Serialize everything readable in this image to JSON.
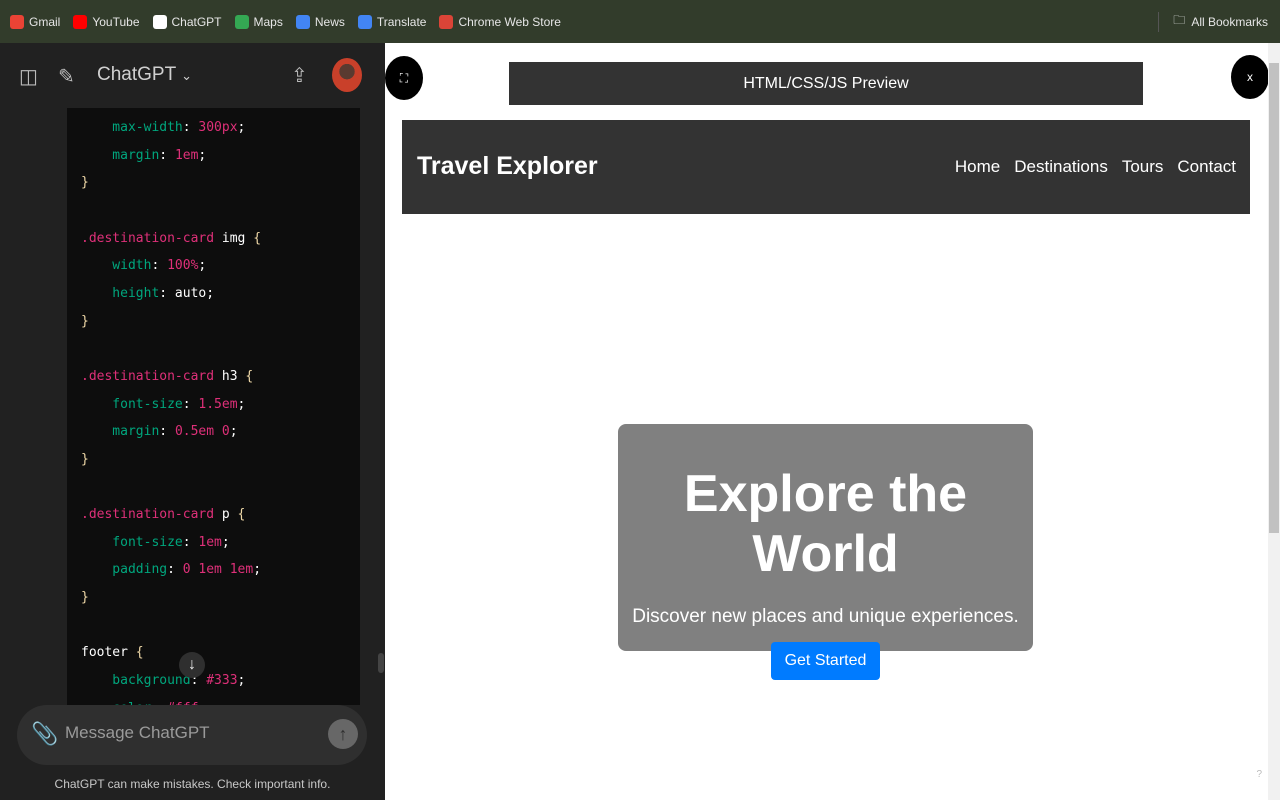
{
  "bookmarks": [
    {
      "label": "Gmail",
      "color": "#ea4335"
    },
    {
      "label": "YouTube",
      "color": "#ff0000"
    },
    {
      "label": "ChatGPT",
      "color": "#ffffff"
    },
    {
      "label": "Maps",
      "color": "#34a853"
    },
    {
      "label": "News",
      "color": "#4285f4"
    },
    {
      "label": "Translate",
      "color": "#4285f4"
    },
    {
      "label": "Chrome Web Store",
      "color": "#db4437"
    }
  ],
  "all_bookmarks": "All Bookmarks",
  "chat": {
    "title": "ChatGPT",
    "placeholder": "Message ChatGPT",
    "disclaimer": "ChatGPT can make mistakes. Check important info."
  },
  "code_lines": [
    [
      [
        "prop",
        "    max-width"
      ],
      [
        "p",
        ": "
      ],
      [
        "val",
        "300px"
      ],
      [
        "p",
        ";"
      ]
    ],
    [
      [
        "prop",
        "    margin"
      ],
      [
        "p",
        ": "
      ],
      [
        "val",
        "1em"
      ],
      [
        "p",
        ";"
      ]
    ],
    [
      [
        "br",
        "}"
      ]
    ],
    [],
    [
      [
        "sel",
        ".destination-card"
      ],
      [
        "p",
        " img "
      ],
      [
        "br",
        "{"
      ]
    ],
    [
      [
        "prop",
        "    width"
      ],
      [
        "p",
        ": "
      ],
      [
        "val",
        "100%"
      ],
      [
        "p",
        ";"
      ]
    ],
    [
      [
        "prop",
        "    height"
      ],
      [
        "p",
        ": auto;"
      ]
    ],
    [
      [
        "br",
        "}"
      ]
    ],
    [],
    [
      [
        "sel",
        ".destination-card"
      ],
      [
        "p",
        " h3 "
      ],
      [
        "br",
        "{"
      ]
    ],
    [
      [
        "prop",
        "    font-size"
      ],
      [
        "p",
        ": "
      ],
      [
        "val",
        "1.5em"
      ],
      [
        "p",
        ";"
      ]
    ],
    [
      [
        "prop",
        "    margin"
      ],
      [
        "p",
        ": "
      ],
      [
        "val",
        "0.5em 0"
      ],
      [
        "p",
        ";"
      ]
    ],
    [
      [
        "br",
        "}"
      ]
    ],
    [],
    [
      [
        "sel",
        ".destination-card"
      ],
      [
        "p",
        " p "
      ],
      [
        "br",
        "{"
      ]
    ],
    [
      [
        "prop",
        "    font-size"
      ],
      [
        "p",
        ": "
      ],
      [
        "val",
        "1em"
      ],
      [
        "p",
        ";"
      ]
    ],
    [
      [
        "prop",
        "    padding"
      ],
      [
        "p",
        ": "
      ],
      [
        "val",
        "0 1em 1em"
      ],
      [
        "p",
        ";"
      ]
    ],
    [
      [
        "br",
        "}"
      ]
    ],
    [],
    [
      [
        "p",
        "footer "
      ],
      [
        "br",
        "{"
      ]
    ],
    [
      [
        "prop",
        "    background"
      ],
      [
        "p",
        ": "
      ],
      [
        "val",
        "#333"
      ],
      [
        "p",
        ";"
      ]
    ],
    [
      [
        "prop",
        "    color"
      ],
      [
        "p",
        ": "
      ],
      [
        "val",
        "#fff"
      ],
      [
        "p",
        ";"
      ]
    ]
  ],
  "preview": {
    "header": "HTML/CSS/JS Preview",
    "fullscreen_icon": "expand-icon",
    "close_label": "x",
    "brand": "Travel Explorer",
    "nav": [
      "Home",
      "Destinations",
      "Tours",
      "Contact"
    ],
    "hero_title": "Explore the World",
    "hero_text": "Discover new places and unique experiences.",
    "cta": "Get Started",
    "corner": "?",
    "accent": "#007bff"
  }
}
